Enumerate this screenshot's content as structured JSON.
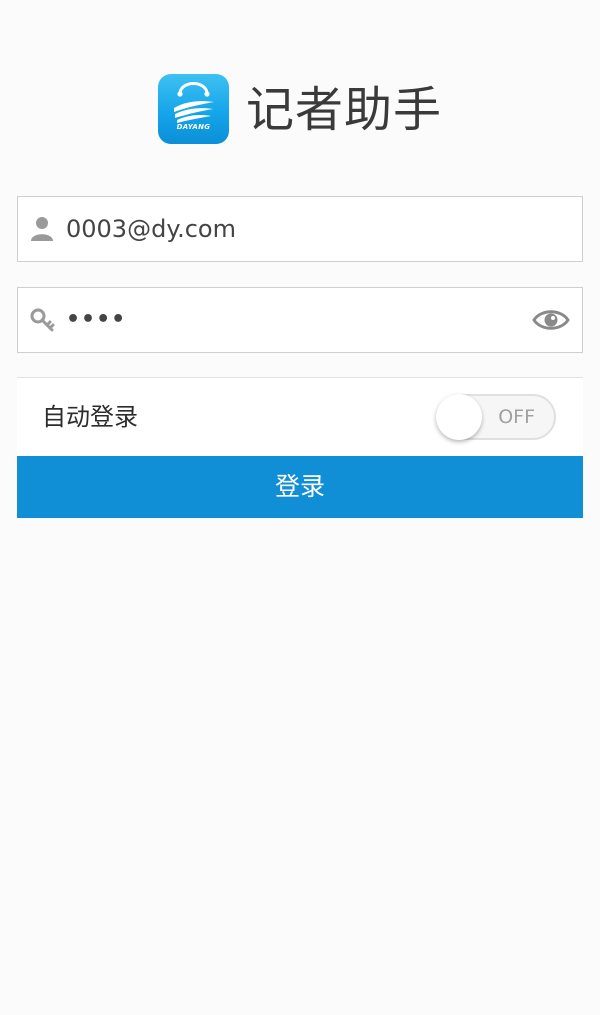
{
  "app": {
    "title": "记者助手",
    "logo_brand": "DAYANG"
  },
  "form": {
    "username_value": "0003@dy.com",
    "password_value": "••••",
    "username_icon": "user-icon",
    "password_icon": "key-icon",
    "visibility_icon": "eye-icon"
  },
  "auto_login": {
    "label": "自动登录",
    "state": "OFF"
  },
  "login_button": {
    "label": "登录"
  },
  "colors": {
    "primary": "#118fd6",
    "logo_blue": "#15a5ea",
    "text_dark": "#3a3a3a",
    "background": "#fbfbfb"
  }
}
